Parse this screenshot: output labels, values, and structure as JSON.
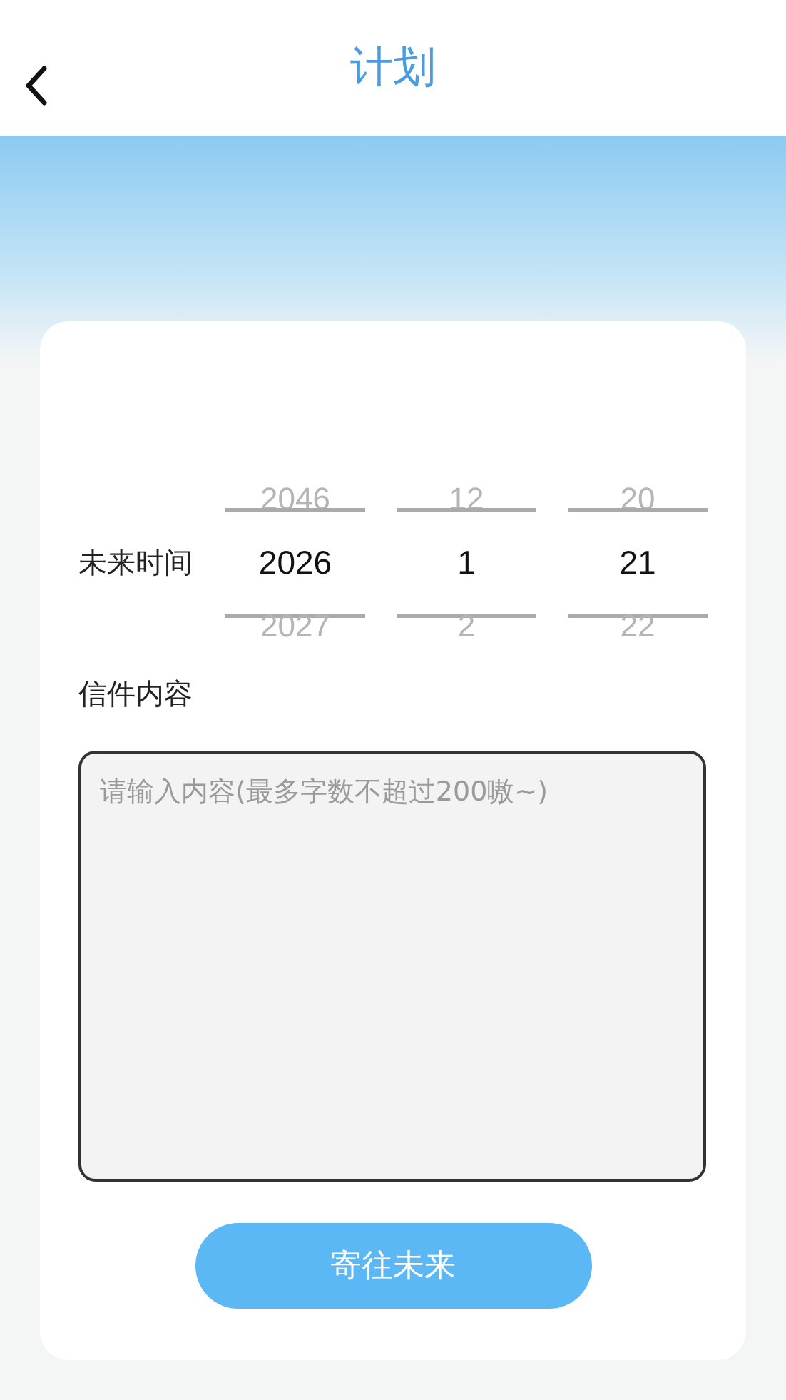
{
  "header": {
    "title": "计划"
  },
  "form": {
    "time_label": "未来时间",
    "pickers": [
      {
        "prev": "2046",
        "current": "2026",
        "next": "2027"
      },
      {
        "prev": "12",
        "current": "1",
        "next": "2"
      },
      {
        "prev": "20",
        "current": "21",
        "next": "22"
      }
    ],
    "content_label": "信件内容",
    "content": {
      "placeholder": "请输入内容(最多字数不超过200嗷~)"
    },
    "submit_button": "寄往未来"
  }
}
